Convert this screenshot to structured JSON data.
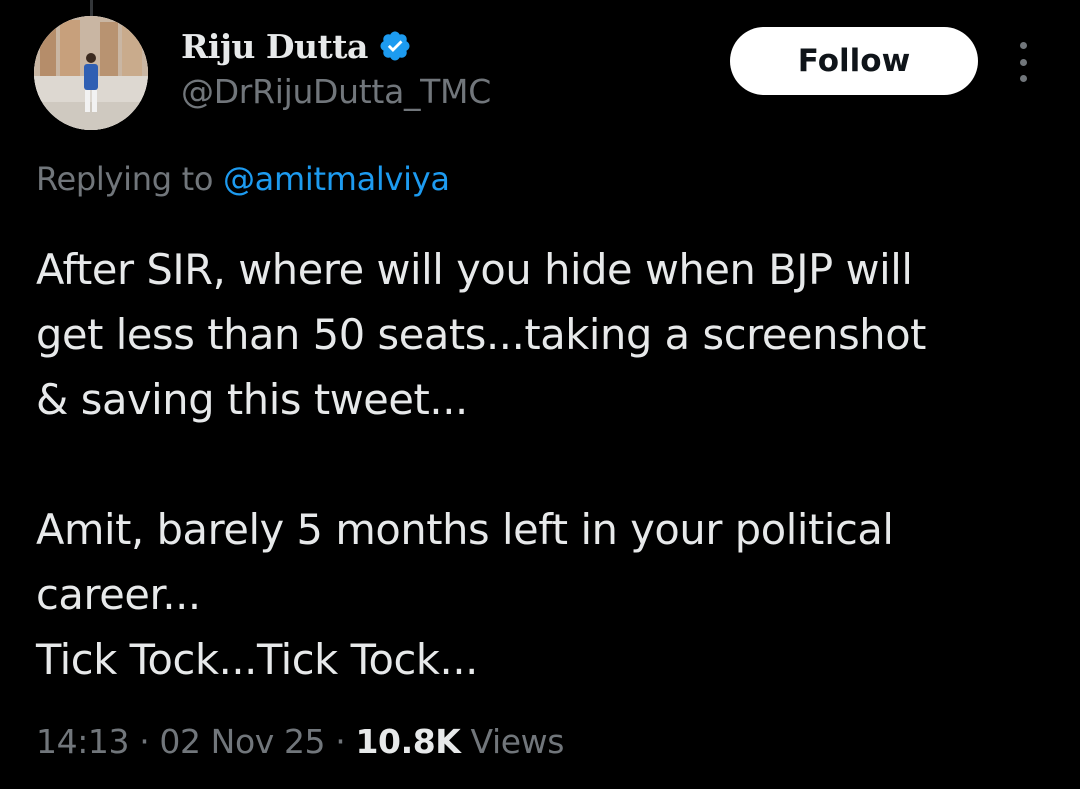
{
  "author": {
    "display_name": "Riju Dutta",
    "handle": "@DrRijuDutta_TMC",
    "verified_icon": "verified-badge-icon",
    "avatar": "profile-photo"
  },
  "actions": {
    "follow_label": "Follow",
    "more_icon": "more-options-icon"
  },
  "reply": {
    "prefix": "Replying to ",
    "to_handle": "@amitmalviya"
  },
  "tweet": {
    "lines": [
      "After SIR, where will you hide when BJP will",
      "get less than 50 seats...taking a screenshot",
      "& saving this tweet...",
      "",
      "Amit, barely 5 months left in your political",
      "career...",
      "Tick Tock...Tick Tock..."
    ]
  },
  "meta": {
    "time": "14:13",
    "separator": " · ",
    "date": "02 Nov 25",
    "views_count": "10.8K",
    "views_label": "Views"
  },
  "colors": {
    "background": "#000000",
    "primary_text": "#e7e9ea",
    "secondary_text": "#71767b",
    "link": "#1d9bf0",
    "verified": "#1d9bf0"
  }
}
